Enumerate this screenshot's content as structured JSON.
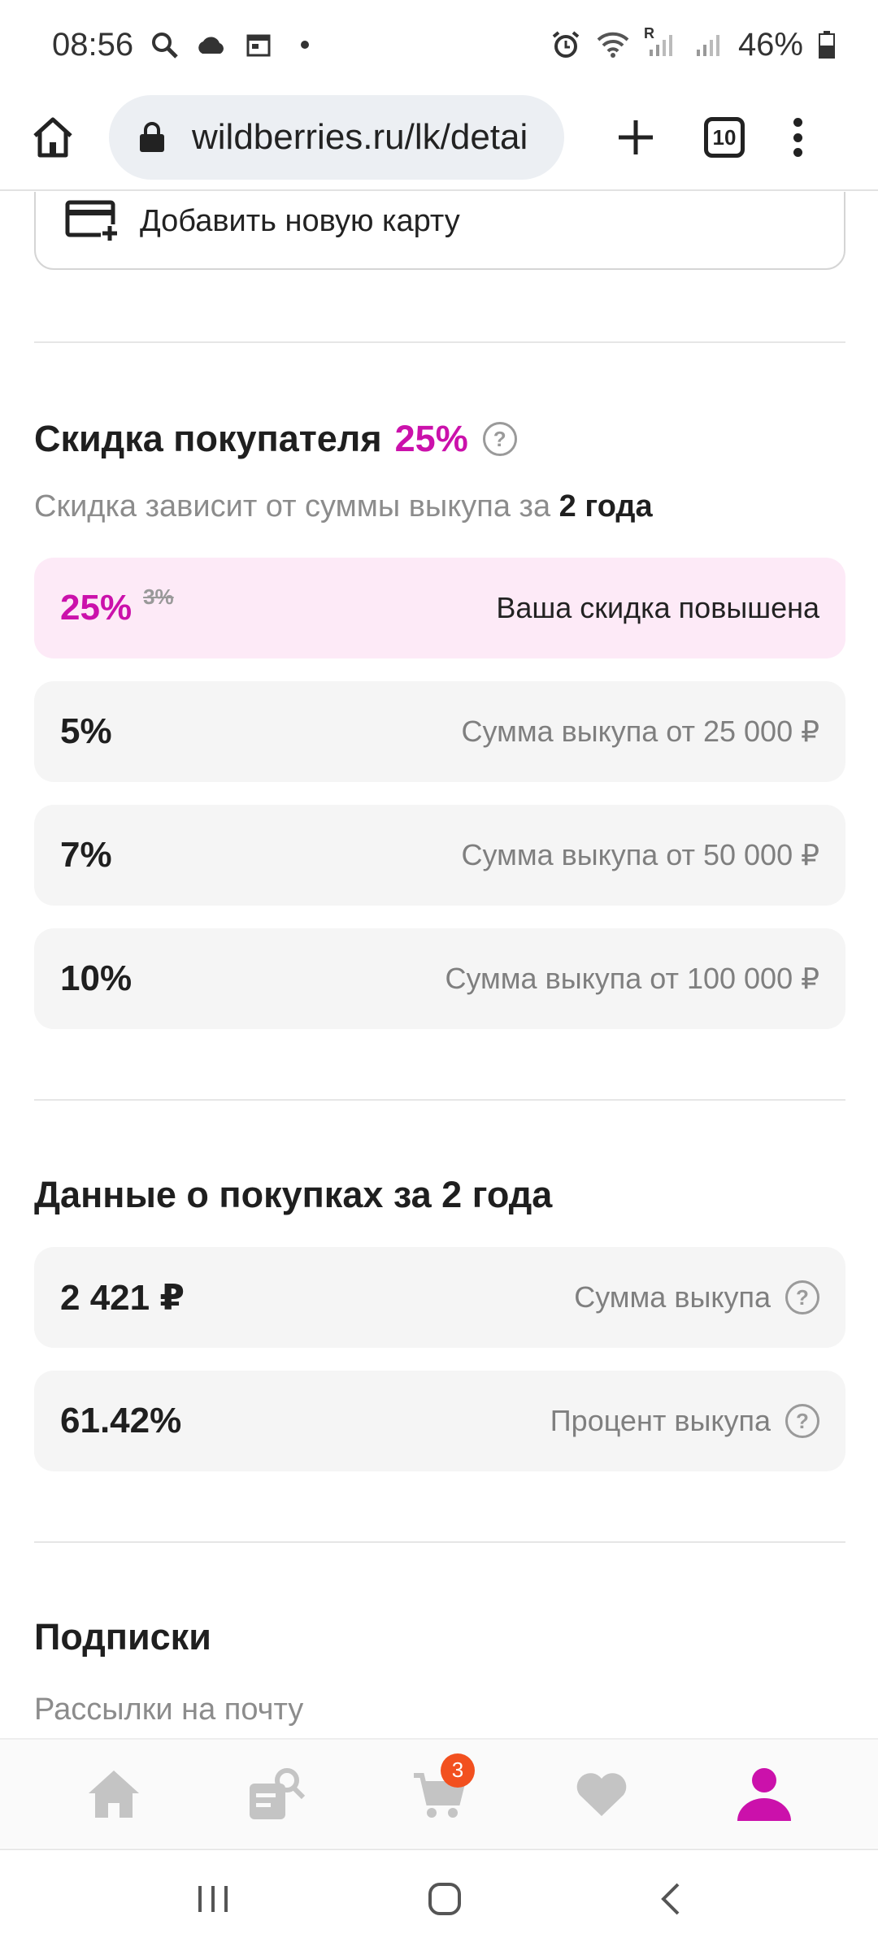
{
  "status_bar": {
    "time": "08:56",
    "battery": "46%",
    "signal_label": "R"
  },
  "browser": {
    "url": "wildberries.ru/lk/detai",
    "tab_count": "10"
  },
  "add_card": {
    "label": "Добавить новую карту"
  },
  "discount": {
    "title": "Скидка покупателя",
    "value": "25%",
    "subtitle_prefix": "Скидка зависит от суммы выкупа за",
    "subtitle_period": "2 года",
    "current": {
      "value": "25%",
      "old_value": "3%",
      "note": "Ваша скидка повышена"
    },
    "tiers": [
      {
        "value": "5%",
        "note": "Сумма выкупа от 25 000 ₽"
      },
      {
        "value": "7%",
        "note": "Сумма выкупа от 50 000 ₽"
      },
      {
        "value": "10%",
        "note": "Сумма выкупа от 100 000 ₽"
      }
    ]
  },
  "purchases": {
    "title": "Данные о покупках за 2 года",
    "items": [
      {
        "value": "2 421 ₽",
        "label": "Сумма выкупа"
      },
      {
        "value": "61.42%",
        "label": "Процент выкупа"
      }
    ]
  },
  "subscriptions": {
    "title": "Подписки",
    "subtitle": "Рассылки на почту"
  },
  "bottom_nav": {
    "cart_badge": "3",
    "active_color": "#cb11ab",
    "inactive_color": "#c4c4c4"
  },
  "colors": {
    "accent": "#cb11ab",
    "badge": "#f2501f"
  }
}
